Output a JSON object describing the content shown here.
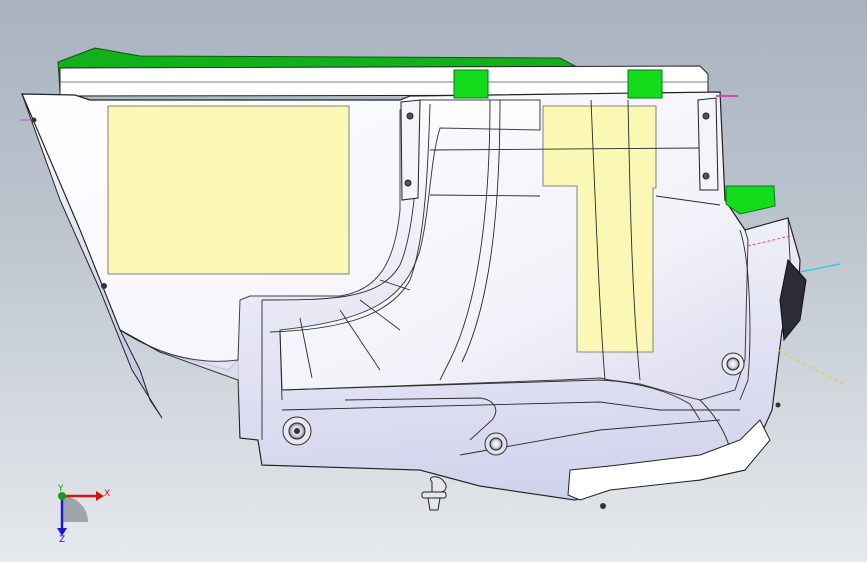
{
  "viewport": {
    "background_top": "#a9b3c0",
    "background_bottom": "#e6e9ed",
    "part_face_color": "#ffffff",
    "part_shade_color": "#c9cbe6",
    "edge_color": "#222222",
    "highlight_region_color": "#fbf7b4",
    "green_feature_color": "#12dc1c"
  },
  "triad": {
    "x_label": "X",
    "y_label": "Y",
    "z_label": "Z",
    "x_color": "#e01010",
    "y_color": "#10a010",
    "z_color": "#1a1ad0"
  }
}
